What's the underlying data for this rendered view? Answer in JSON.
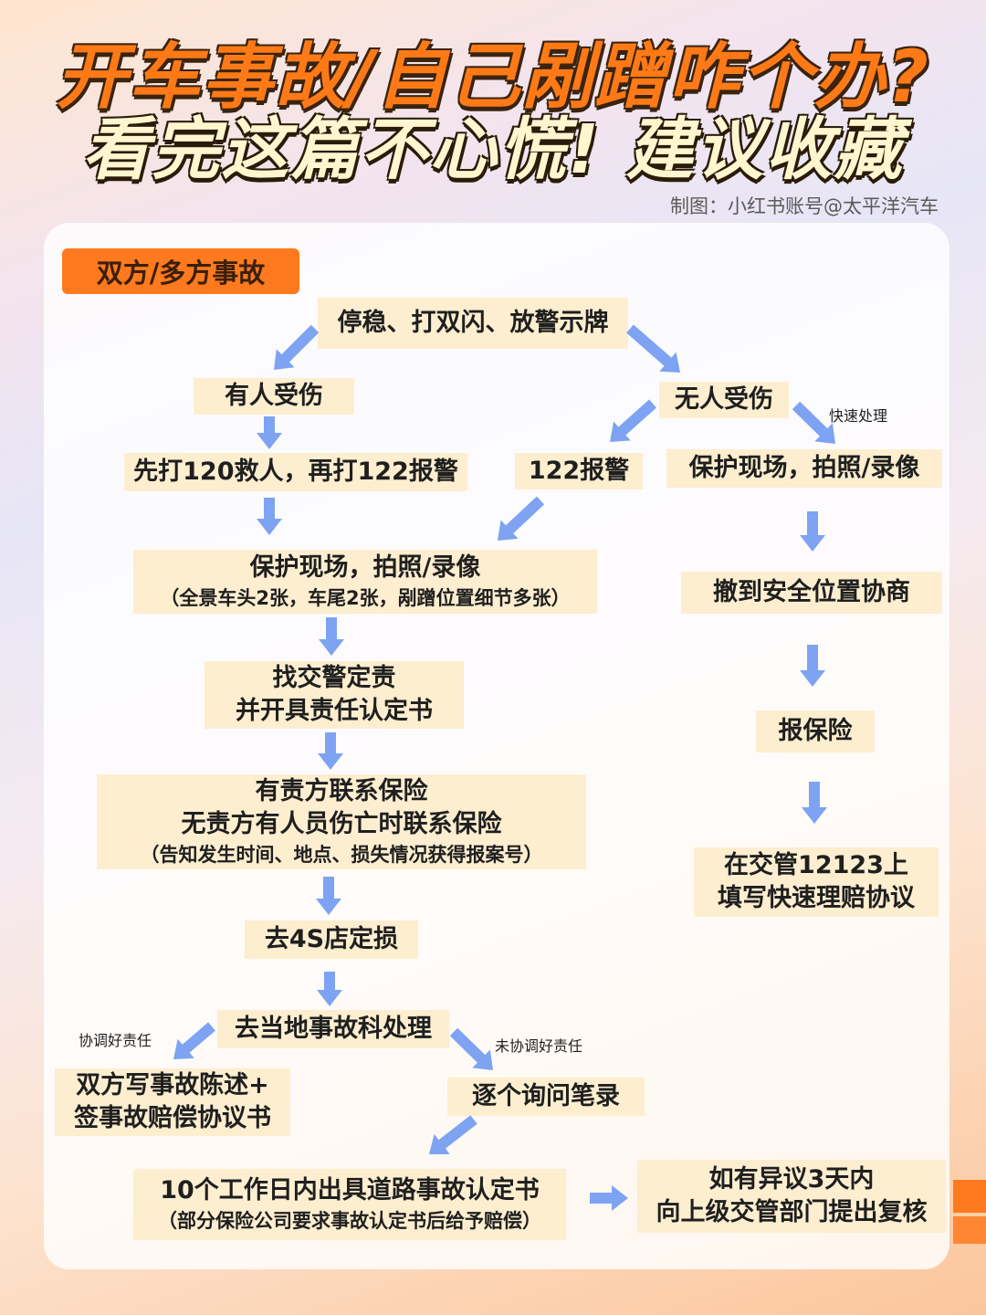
{
  "header": {
    "title_line1": "开车事故/自己剐蹭咋个办?",
    "title_line2": "看完这篇不心慌! 建议收藏",
    "credit": "制图：小红书账号@太平洋汽车"
  },
  "section": {
    "label": "双方/多方事故"
  },
  "steps": {
    "start": "停稳、打双闪、放警示牌",
    "injured": "有人受伤",
    "no_injury": "无人受伤",
    "call_120": "先打120救人，再打122报警",
    "call_122": "122报警",
    "protect_right": "保护现场，拍照/录像",
    "protect_main": "保护现场，拍照/录像",
    "protect_main_sub": "（全景车头2张，车尾2张，剐蹭位置细节多张）",
    "police_line1": "找交警定责",
    "police_line2": "并开具责任认定书",
    "insurance_line1": "有责方联系保险",
    "insurance_line2": "无责方有人员伤亡时联系保险",
    "insurance_sub": "（告知发生时间、地点、损失情况获得报案号）",
    "shop": "去4S店定损",
    "local_dept": "去当地事故科处理",
    "statement_line1": "双方写事故陈述+",
    "statement_line2": "签事故赔偿协议书",
    "interview": "逐个询问笔录",
    "certificate": "10个工作日内出具道路事故认定书",
    "certificate_sub": "（部分保险公司要求事故认定书后给予赔偿）",
    "appeal_line1": "如有异议3天内",
    "appeal_line2": "向上级交管部门提出复核",
    "safe_place": "撤到安全位置协商",
    "report_ins": "报保险",
    "app_line1": "在交管12123上",
    "app_line2": "填写快速理赔协议"
  },
  "notes": {
    "quick": "快速处理",
    "agreed": "协调好责任",
    "not_agreed": "未协调好责任"
  },
  "colors": {
    "accent": "#ff7a1e",
    "box": "#fdeed0",
    "arrow": "#7ea3f3"
  }
}
